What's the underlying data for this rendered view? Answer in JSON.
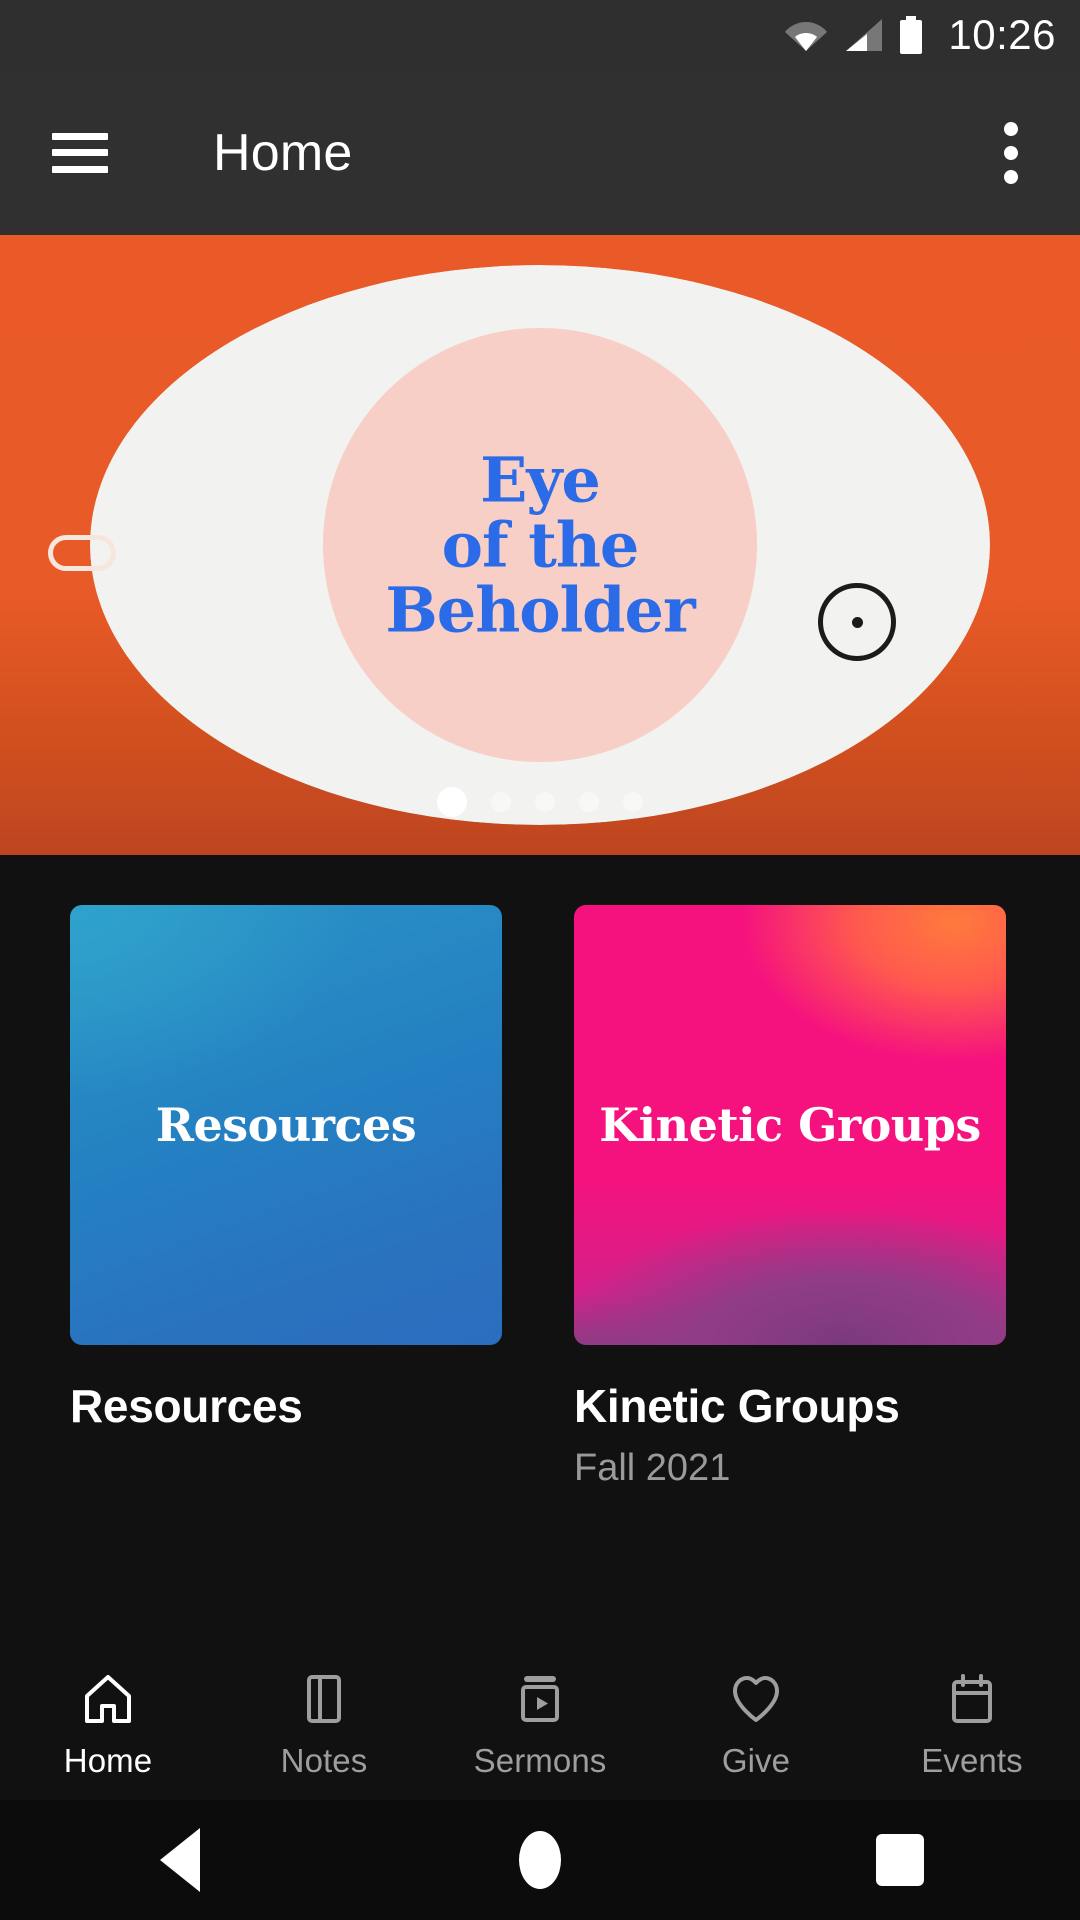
{
  "status_bar": {
    "time": "10:26",
    "icons": [
      "wifi-icon",
      "cellular-signal-icon",
      "battery-icon"
    ]
  },
  "app_bar": {
    "menu_icon": "hamburger-menu-icon",
    "title": "Home",
    "overflow_icon": "overflow-menu-icon"
  },
  "hero": {
    "title_lines": [
      "Eye",
      "of the",
      "Beholder"
    ],
    "background_color": "#E95A28",
    "background_color_bottom": "#BE4520",
    "eye_white_color": "#F2F2F0",
    "lens_color": "#F8CFC6",
    "text_color": "#2B6BE8",
    "carousel": {
      "total": 5,
      "active_index": 0
    },
    "decorations": [
      "pill-outline-top-left",
      "circle-dot-outline",
      "pill-outline-bottom-right"
    ]
  },
  "cards": [
    {
      "tile_label": "Resources",
      "title": "Resources",
      "subtitle": "",
      "accent": "#2480C2"
    },
    {
      "tile_label": "Kinetic Groups",
      "title": "Kinetic Groups",
      "subtitle": "Fall 2021",
      "accent": "#F5127E"
    }
  ],
  "bottom_nav": {
    "active": "Home",
    "items": [
      {
        "label": "Home",
        "icon": "home-icon"
      },
      {
        "label": "Notes",
        "icon": "notes-icon"
      },
      {
        "label": "Sermons",
        "icon": "sermons-video-icon"
      },
      {
        "label": "Give",
        "icon": "heart-icon"
      },
      {
        "label": "Events",
        "icon": "calendar-icon"
      }
    ]
  },
  "system_nav": {
    "back": "back-button",
    "home": "home-button",
    "recents": "recents-button"
  }
}
